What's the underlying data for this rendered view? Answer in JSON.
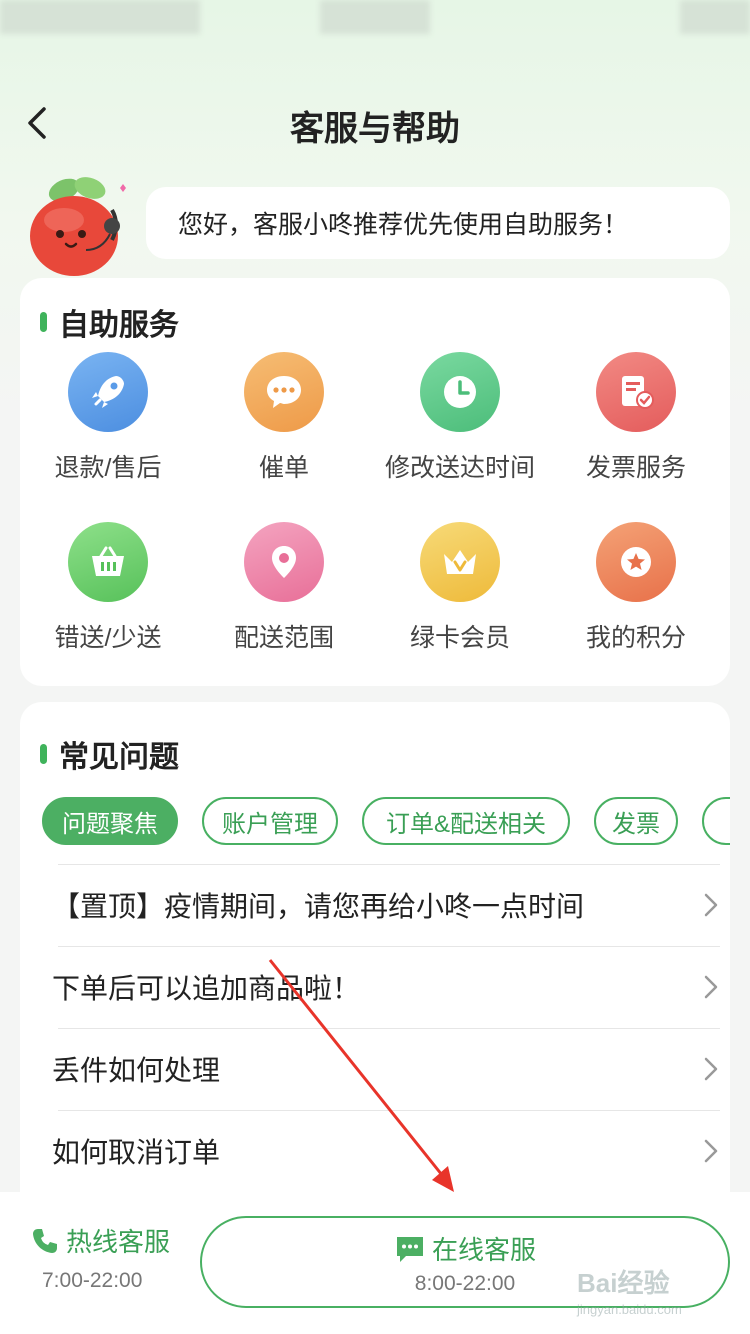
{
  "nav": {
    "title": "客服与帮助"
  },
  "greeting": "您好，客服小咚推荐优先使用自助服务！",
  "self_service": {
    "title": "自助服务",
    "items": [
      {
        "label": "退款/售后",
        "icon": "rocket-icon",
        "color": "#5a9be8"
      },
      {
        "label": "催单",
        "icon": "chat-dots-icon",
        "color": "#f0a85a"
      },
      {
        "label": "修改送达时间",
        "icon": "clock-icon",
        "color": "#5ecb8a"
      },
      {
        "label": "发票服务",
        "icon": "invoice-icon",
        "color": "#ea6a6a"
      },
      {
        "label": "错送/少送",
        "icon": "basket-icon",
        "color": "#6ccf6a"
      },
      {
        "label": "配送范围",
        "icon": "location-pin-icon",
        "color": "#ee86a8"
      },
      {
        "label": "绿卡会员",
        "icon": "crown-icon",
        "color": "#f3c950"
      },
      {
        "label": "我的积分",
        "icon": "star-badge-icon",
        "color": "#ef8a5c"
      }
    ]
  },
  "faq": {
    "title": "常见问题",
    "tabs": [
      {
        "label": "问题聚焦",
        "active": true
      },
      {
        "label": "账户管理",
        "active": false
      },
      {
        "label": "订单&配送相关",
        "active": false
      },
      {
        "label": "发票",
        "active": false
      }
    ],
    "questions": [
      "【置顶】疫情期间，请您再给小咚一点时间",
      "下单后可以追加商品啦！",
      "丢件如何处理",
      "如何取消订单"
    ]
  },
  "bottom": {
    "hotline_label": "热线客服",
    "hotline_hours": "7:00-22:00",
    "online_label": "在线客服",
    "online_hours": "8:00-22:00"
  },
  "watermark": {
    "brand": "Bai经验",
    "domain": "jingyan.baidu.com"
  },
  "colors": {
    "accent": "#4caf63",
    "annotation_arrow": "#e8342a"
  }
}
